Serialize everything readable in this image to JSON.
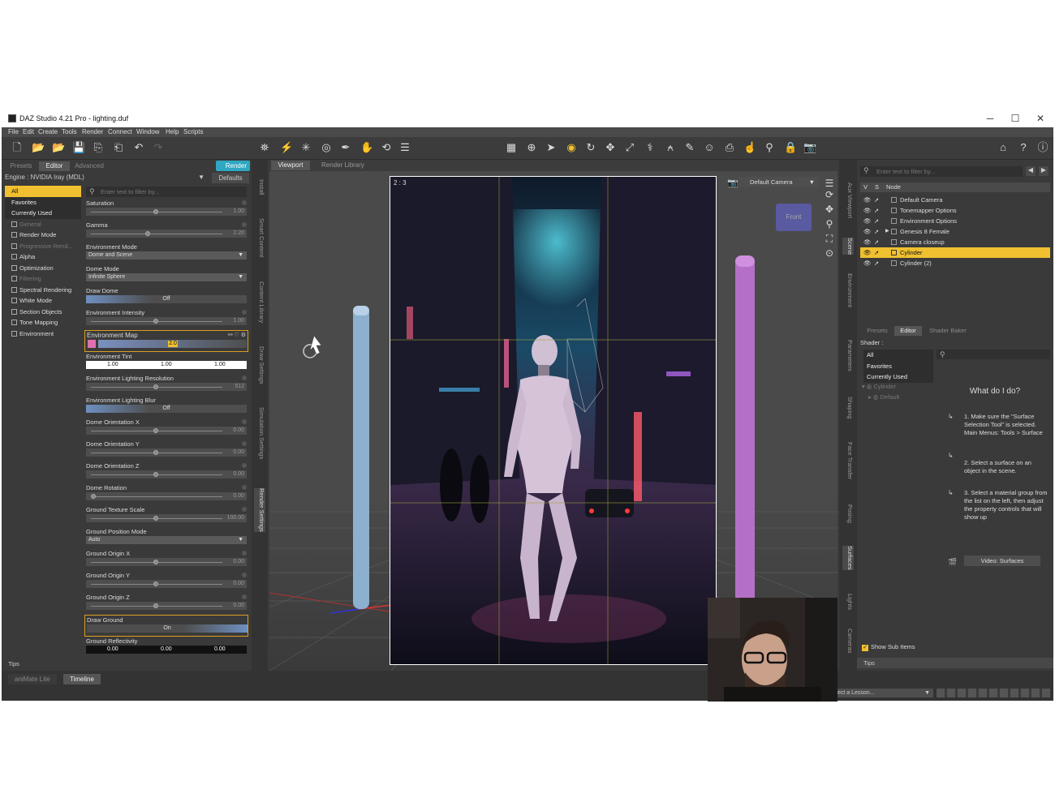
{
  "window": {
    "title": "DAZ Studio 4.21 Pro - lighting.duf",
    "min": "─",
    "max": "☐",
    "close": "✕"
  },
  "menu": [
    "File",
    "Edit",
    "Create",
    "Tools",
    "Render",
    "Connect",
    "Window",
    "Help",
    "Scripts"
  ],
  "left_tabs": {
    "presets": "Presets",
    "editor": "Editor",
    "advanced": "Advanced",
    "render": "Render"
  },
  "engine": {
    "label": "Engine :",
    "value": "NVIDIA Iray (MDL)",
    "defaults": "Defaults"
  },
  "filter_placeholder": "Enter text to filter by...",
  "categories": [
    "All",
    "Favorites",
    "Currently Used",
    "General",
    "Render Mode",
    "Progressive Rend...",
    "Alpha",
    "Optimization",
    "Filtering",
    "Spectral Rendering",
    "White Mode",
    "Section Objects",
    "Tone Mapping",
    "Environment"
  ],
  "show_sub_items": "Show Sub Items",
  "props": {
    "saturation": {
      "label": "Saturation",
      "value": "1.00"
    },
    "gamma": {
      "label": "Gamma",
      "value": "2.20"
    },
    "env_mode": {
      "label": "Environment Mode",
      "value": "Dome and Scene"
    },
    "dome_mode": {
      "label": "Dome Mode",
      "value": "Infinite Sphere"
    },
    "draw_dome": {
      "label": "Draw Dome",
      "value": "Off"
    },
    "env_intensity": {
      "label": "Environment Intensity",
      "value": "1.00"
    },
    "env_map": {
      "label": "Environment Map",
      "value": "2.0"
    },
    "env_tint": {
      "label": "Environment Tint",
      "r": "1.00",
      "g": "1.00",
      "b": "1.00"
    },
    "env_light_res": {
      "label": "Environment Lighting Resolution",
      "value": "512"
    },
    "env_light_blur": {
      "label": "Environment Lighting Blur",
      "value": "Off"
    },
    "dome_ox": {
      "label": "Dome Orientation X",
      "value": "0.00"
    },
    "dome_oy": {
      "label": "Dome Orientation Y",
      "value": "0.00"
    },
    "dome_oz": {
      "label": "Dome Orientation Z",
      "value": "0.00"
    },
    "dome_rot": {
      "label": "Dome Rotation",
      "value": "0.00"
    },
    "ground_tex": {
      "label": "Ground Texture Scale",
      "value": "100.00"
    },
    "ground_pos": {
      "label": "Ground Position Mode",
      "value": "Auto"
    },
    "go_x": {
      "label": "Ground Origin X",
      "value": "0.00"
    },
    "go_y": {
      "label": "Ground Origin Y",
      "value": "0.00"
    },
    "go_z": {
      "label": "Ground Origin Z",
      "value": "0.00"
    },
    "draw_ground": {
      "label": "Draw Ground",
      "value": "On"
    },
    "ground_refl": {
      "label": "Ground Reflectivity",
      "r": "0.00",
      "g": "0.00",
      "b": "0.00"
    }
  },
  "left_vtabs": [
    "Install",
    "Smart Content",
    "Content Library",
    "Draw Settings",
    "Simulation Settings",
    "Render Settings"
  ],
  "tips": "Tips",
  "bottom_tabs": {
    "animate": "aniMate Lite",
    "timeline": "Timeline"
  },
  "viewport_tabs": {
    "viewport": "Viewport",
    "render_library": "Render Library"
  },
  "aspect": "2 : 3",
  "camera": "Default Camera",
  "navcube": "Front",
  "scene_filter": "Enter text to filter by...",
  "scene_head": {
    "v": "V",
    "s": "S",
    "node": "Node"
  },
  "nodes": [
    "Default Camera",
    "Tonemapper Options",
    "Environment Options",
    "Genesis 8 Female",
    "Camera closeup",
    "Cylinder",
    "Cylinder (2)"
  ],
  "right_tabs": {
    "presets": "Presets",
    "editor": "Editor",
    "shader_baker": "Shader Baker"
  },
  "shader_label": "Shader :",
  "shader_cats": [
    "All",
    "Favorites",
    "Currently Used"
  ],
  "shader_tree": [
    "Cylinder",
    "Default"
  ],
  "what_title": "What do I do?",
  "steps": [
    "1. Make sure the \"Surface Selection Tool\" is selected. Main Menus: Tools > Surface",
    "2. Select a surface on an object in the scene.",
    "3. Select a material group from the list on the left, then adjust the property controls that will show up"
  ],
  "video_btn": "Video: Surfaces",
  "right_vtabs": [
    "Aux Viewport",
    "Scene",
    "Environment",
    "Parameters",
    "Shaping",
    "Face Transfer",
    "Posing",
    "Surfaces",
    "Lights",
    "Cameras"
  ],
  "lesson": "ect a Lesson...",
  "colors": {
    "accent": "#f0c030",
    "render": "#2fa7c2",
    "bg": "#3c3c3c"
  }
}
